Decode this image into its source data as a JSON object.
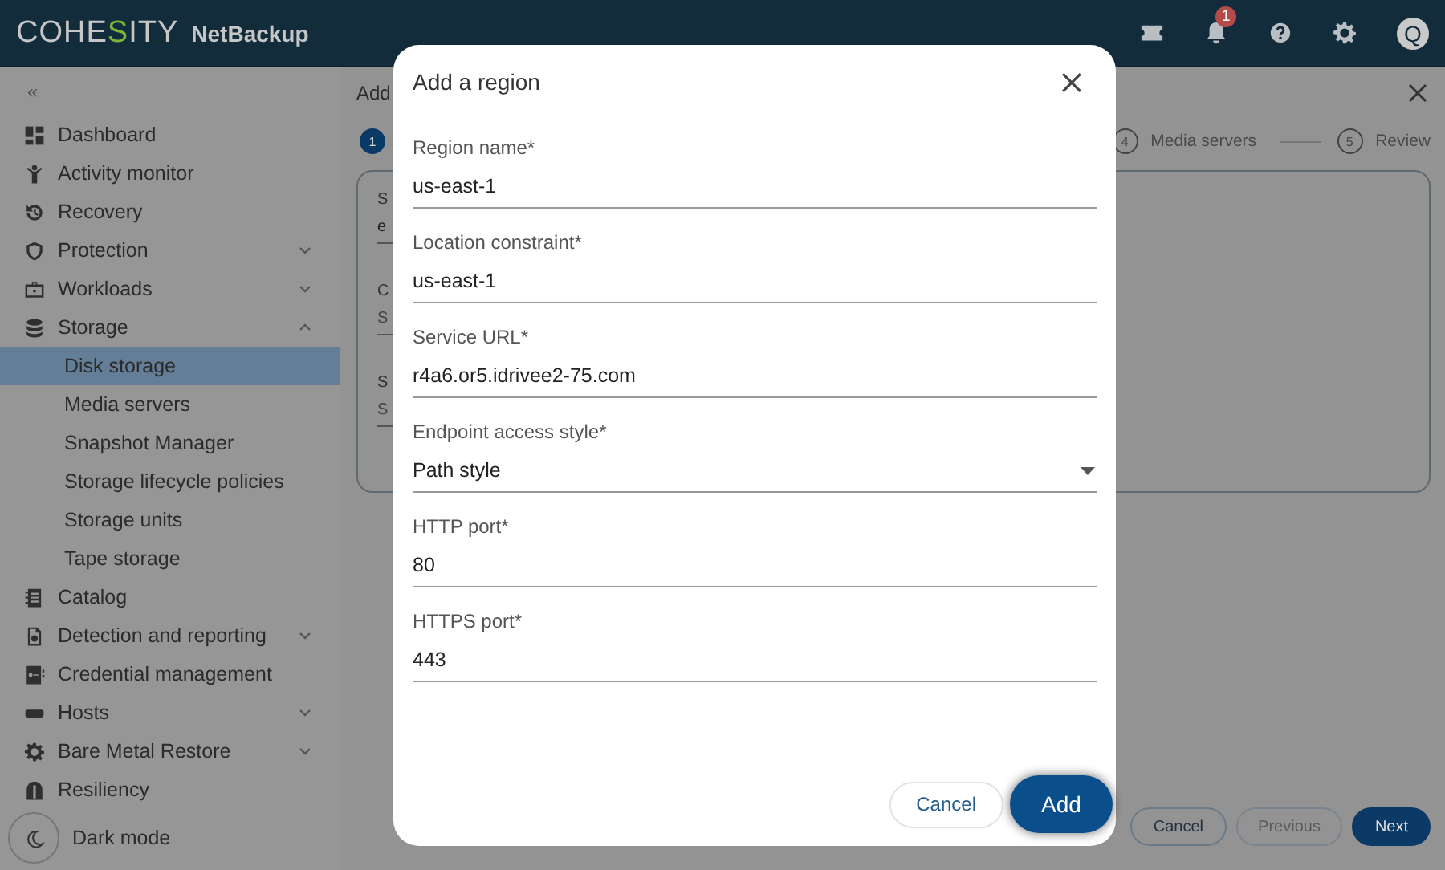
{
  "topbar": {
    "brand_parts": [
      "COHE",
      "S",
      "ITY"
    ],
    "product": "NetBackup",
    "notification_count": "1",
    "avatar": "Q"
  },
  "sidebar": {
    "collapse": "«",
    "items": [
      {
        "label": "Dashboard",
        "selected": false
      },
      {
        "label": "Activity monitor",
        "selected": false
      },
      {
        "label": "Recovery",
        "selected": false
      },
      {
        "label": "Protection",
        "selected": false,
        "expanded": false
      },
      {
        "label": "Workloads",
        "selected": false,
        "expanded": false
      },
      {
        "label": "Storage",
        "selected": false,
        "expanded": true,
        "children": [
          {
            "label": "Disk storage",
            "selected": true
          },
          {
            "label": "Media servers",
            "selected": false
          },
          {
            "label": "Snapshot Manager",
            "selected": false
          },
          {
            "label": "Storage lifecycle policies",
            "selected": false
          },
          {
            "label": "Storage units",
            "selected": false
          },
          {
            "label": "Tape storage",
            "selected": false
          }
        ]
      },
      {
        "label": "Catalog",
        "selected": false
      },
      {
        "label": "Detection and reporting",
        "selected": false,
        "expanded": false
      },
      {
        "label": "Credential management",
        "selected": false
      },
      {
        "label": "Hosts",
        "selected": false,
        "expanded": false
      },
      {
        "label": "Bare Metal Restore",
        "selected": false,
        "expanded": false
      },
      {
        "label": "Resiliency",
        "selected": false
      }
    ],
    "dark_mode": {
      "label": "Dark mode"
    }
  },
  "wizard": {
    "title": "Add",
    "steps": [
      {
        "number": "1",
        "current": true
      },
      {
        "number": "4",
        "label": "Media servers",
        "current": false
      },
      {
        "number": "5",
        "label": "Review",
        "current": false
      }
    ],
    "fields": [
      {
        "label": "S",
        "value": "e"
      },
      {
        "label": "C",
        "placeholder": "S"
      },
      {
        "label": "S",
        "placeholder": "S"
      }
    ],
    "buttons": [
      {
        "label": "Cancel",
        "kind": "outline",
        "disabled": false
      },
      {
        "label": "Previous",
        "kind": "outline",
        "disabled": true
      },
      {
        "label": "Next",
        "kind": "primary",
        "disabled": false
      }
    ]
  },
  "dialog": {
    "title": "Add a region",
    "fields": [
      {
        "label": "Region name",
        "required_mark": "*",
        "value": "us-east-1",
        "kind": "text"
      },
      {
        "label": "Location constraint",
        "required_mark": "*",
        "value": "us-east-1",
        "kind": "text"
      },
      {
        "label": "Service URL",
        "required_mark": "*",
        "value": "r4a6.or5.idrivee2-75.com",
        "kind": "text"
      },
      {
        "label": "Endpoint access style",
        "required_mark": "*",
        "value": "Path style",
        "kind": "select"
      },
      {
        "label": "HTTP port",
        "required_mark": "*",
        "value": "80",
        "kind": "text"
      },
      {
        "label": "HTTPS port",
        "required_mark": "*",
        "value": "443",
        "kind": "text"
      }
    ],
    "buttons": [
      {
        "label": "Cancel",
        "kind": "outline"
      },
      {
        "label": "Add",
        "kind": "primary"
      }
    ]
  }
}
